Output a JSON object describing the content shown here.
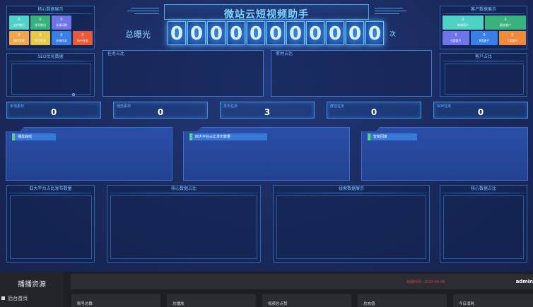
{
  "header": {
    "title": "微站云短视频助手",
    "exposure_label": "总曝光",
    "digits": [
      "0",
      "0",
      "0",
      "0",
      "0",
      "0",
      "0",
      "0",
      "0",
      "0",
      "0"
    ],
    "unit": "次"
  },
  "core_panel_left": {
    "title": "核心数据展示",
    "tiles": [
      {
        "value": "0",
        "label": "文件数目",
        "color": "#4fd1c5"
      },
      {
        "value": "0",
        "label": "账号数目",
        "color": "#38b27a"
      },
      {
        "value": "0",
        "label": "关键词数",
        "color": "#6f74e8"
      },
      {
        "value": "0",
        "label": "群任务数",
        "color": "#f0a64a"
      },
      {
        "value": "0",
        "label": "今日任务",
        "color": "#e8c84a"
      },
      {
        "value": "0",
        "label": "本周任务",
        "color": "#3a7ee8"
      },
      {
        "value": "0",
        "label": "执行任务",
        "color": "#e85a3a"
      }
    ]
  },
  "customer_panel": {
    "title": "客户数据展示",
    "tiles": [
      {
        "value": "0",
        "label": "新增用户",
        "color": "#4fd1c5"
      },
      {
        "value": "0",
        "label": "跟进客户",
        "color": "#38b27a"
      },
      {
        "value": "0",
        "label": "A类客户",
        "color": "#6f74e8"
      },
      {
        "value": "0",
        "label": "B类客户",
        "color": "#3a7ee8"
      },
      {
        "value": "0",
        "label": "C类客户",
        "color": "#f08a3a"
      }
    ]
  },
  "row2": {
    "seo_title": "SEO优化数据",
    "task_title": "任务占比",
    "material_title": "素材占比",
    "customer_ratio_title": "客户占比"
  },
  "kpis": [
    {
      "label": "本地素材",
      "value": "0"
    },
    {
      "label": "混剪素材",
      "value": "0"
    },
    {
      "label": "发布任务",
      "value": "3"
    },
    {
      "label": "群控任务",
      "value": "0"
    },
    {
      "label": "SOP任务",
      "value": "0"
    }
  ],
  "folders": [
    {
      "tag": "播放曲线"
    },
    {
      "tag": "四大平台占比发布数量"
    },
    {
      "tag": "智能回复"
    }
  ],
  "row4": {
    "p1": "四大平台占比发布数量",
    "p2": "核心数据占比",
    "p3": "线索数据展示",
    "p4": "核心数据占比"
  },
  "app": {
    "sidebar_title": "播播资源",
    "sidebar_item": "后台首页",
    "time": "到期时间：2030-06-08",
    "user": "admin",
    "stats": [
      "账号总数",
      "总播放",
      "视频总点赞",
      "总充值",
      "今日消耗"
    ]
  },
  "colors": {
    "accent": "#6cc2ff",
    "background": "#1b2a5c"
  }
}
